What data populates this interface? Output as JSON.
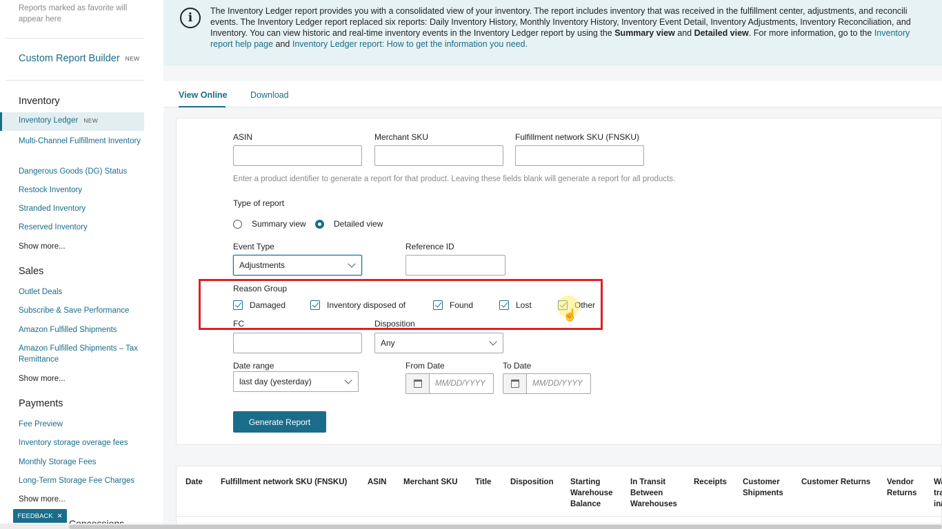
{
  "sidebar": {
    "favorites_hint": "Reports marked as favorite will appear here",
    "custom_report_builder": "Custom Report Builder",
    "new_badge": "NEW",
    "inventory": {
      "title": "Inventory",
      "active_item": "Inventory Ledger",
      "items": [
        "Multi-Channel Fulfillment Inventory",
        "Dangerous Goods (DG) Status",
        "Restock Inventory",
        "Stranded Inventory",
        "Reserved Inventory",
        "Show more..."
      ]
    },
    "sales": {
      "title": "Sales",
      "items": [
        "Outlet Deals",
        "Subscribe & Save Performance",
        "Amazon Fulfilled Shipments",
        "Amazon Fulfilled Shipments – Tax Remittance",
        "Show more..."
      ]
    },
    "payments": {
      "title": "Payments",
      "items": [
        "Fee Preview",
        "Inventory storage overage fees",
        "Monthly Storage Fees",
        "Long-Term Storage Fee Charges",
        "Show more..."
      ]
    },
    "feedback": "FEEDBACK",
    "concessions_partial": "Concessions"
  },
  "banner": {
    "line1": "The Inventory Ledger report provides you with a consolidated view of your inventory. The report includes inventory that was received in the fulfillment center, adjustments, and reconcili",
    "line2": "events. The Inventory Ledger report replaced six reports: Daily Inventory History, Monthly Inventory History, Inventory Event Detail, Inventory Adjustments, Inventory Reconciliation, and",
    "line3_a": "Inventory. You can view historic and real-time inventory events in the Inventory Ledger report by using the ",
    "line3_b": "Summary view",
    "line3_c": " and ",
    "line3_d": "Detailed view",
    "line3_e": ". For more information, go to the ",
    "line3_link": "Inventory",
    "line4_link1": "report help page",
    "line4_mid": " and ",
    "line4_link2": "Inventory Ledger report: How to get the information you need."
  },
  "tabs": {
    "view_online": "View Online",
    "download": "Download"
  },
  "form": {
    "asin_label": "ASIN",
    "msku_label": "Merchant SKU",
    "fnsku_label": "Fulfillment network SKU (FNSKU)",
    "hint": "Enter a product identifier to generate a report for that product. Leaving these fields blank will generate a report for all products.",
    "type_label": "Type of report",
    "summary_view": "Summary view",
    "detailed_view": "Detailed view",
    "event_type_label": "Event Type",
    "event_type_value": "Adjustments",
    "reference_id_label": "Reference ID",
    "reason_group_label": "Reason Group",
    "reasons": [
      "Damaged",
      "Inventory disposed of",
      "Found",
      "Lost",
      "Other"
    ],
    "fc_label": "FC",
    "disposition_label": "Disposition",
    "disposition_value": "Any",
    "date_range_label": "Date range",
    "date_range_value": "last day (yesterday)",
    "from_date_label": "From Date",
    "to_date_label": "To Date",
    "date_placeholder": "MM/DD/YYYY",
    "generate_button": "Generate Report"
  },
  "table": {
    "headers": [
      "Date",
      "Fulfillment network SKU (FNSKU)",
      "ASIN",
      "Merchant SKU",
      "Title",
      "Disposition",
      "Starting Warehouse Balance",
      "In Transit Between Warehouses",
      "Receipts",
      "Customer Shipments",
      "Customer Returns",
      "Vendor Returns",
      "Wa tra in/"
    ]
  },
  "colors": {
    "accent": "#1a6d8a",
    "banner_bg": "#e6f2f4",
    "highlight": "#e01f26"
  }
}
